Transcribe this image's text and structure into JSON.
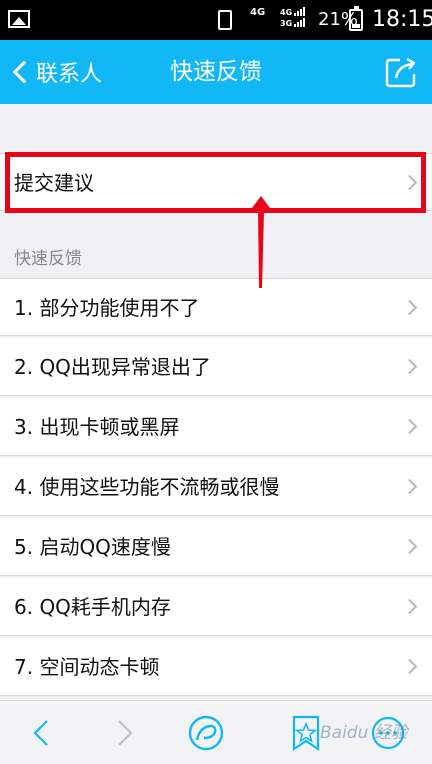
{
  "status_bar": {
    "network_top": "4G",
    "network_bottom": "4G\n3G",
    "battery_percent": "21%",
    "time": "18:15"
  },
  "nav": {
    "back_label": "联系人",
    "title": "快速反馈"
  },
  "submit_row": {
    "label": "提交建议"
  },
  "quick_feedback": {
    "header": "快速反馈",
    "items": [
      {
        "label": "1. 部分功能使用不了"
      },
      {
        "label": "2. QQ出现异常退出了"
      },
      {
        "label": "3. 出现卡顿或黑屏"
      },
      {
        "label": "4. 使用这些功能不流畅或很慢"
      },
      {
        "label": "5. 启动QQ速度慢"
      },
      {
        "label": "6. QQ耗手机内存"
      },
      {
        "label": "7. 空间动态卡顿"
      }
    ]
  },
  "watermark": "Baidu 经验",
  "colors": {
    "nav_bg": "#12b7f5",
    "page_bg": "#efeff4",
    "highlight": "#e6061a",
    "toolbar_icon": "#12b7f5"
  }
}
